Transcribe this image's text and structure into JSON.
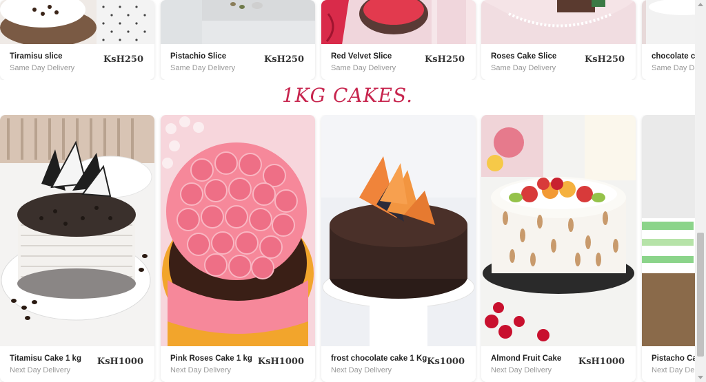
{
  "slices": [
    {
      "name": "Tiramisu slice",
      "delivery": "Same Day Delivery",
      "price": "KsH250"
    },
    {
      "name": "Pistachio Slice",
      "delivery": "Same Day Delivery",
      "price": "KsH250"
    },
    {
      "name": "Red Velvet Slice",
      "delivery": "Same Day Delivery",
      "price": "KsH250"
    },
    {
      "name": "Roses Cake Slice",
      "delivery": "Same Day Delivery",
      "price": "KsH250"
    },
    {
      "name": "chocolate c",
      "delivery": "Same Day De"
    }
  ],
  "section_title": "1KG CAKES.",
  "cakes": [
    {
      "name": "Titamisu Cake 1 kg",
      "delivery": "Next Day Delivery",
      "price": "KsH1000"
    },
    {
      "name": "Pink Roses Cake 1 kg",
      "delivery": "Next Day Delivery",
      "price": "KsH1000"
    },
    {
      "name": "frost chocolate cake 1 Kg",
      "delivery": "Next Day Delivery",
      "price": "Ks1000"
    },
    {
      "name": "Almond Fruit Cake",
      "delivery": "Next Day Delivery",
      "price": "KsH1000"
    },
    {
      "name": "Pistacho Ca",
      "delivery": "Next Day Deliv"
    }
  ],
  "colors": {
    "accent": "#c7254e"
  },
  "icons": {
    "scroll_up": "arrow-up-icon",
    "scroll_down": "arrow-down-icon"
  }
}
